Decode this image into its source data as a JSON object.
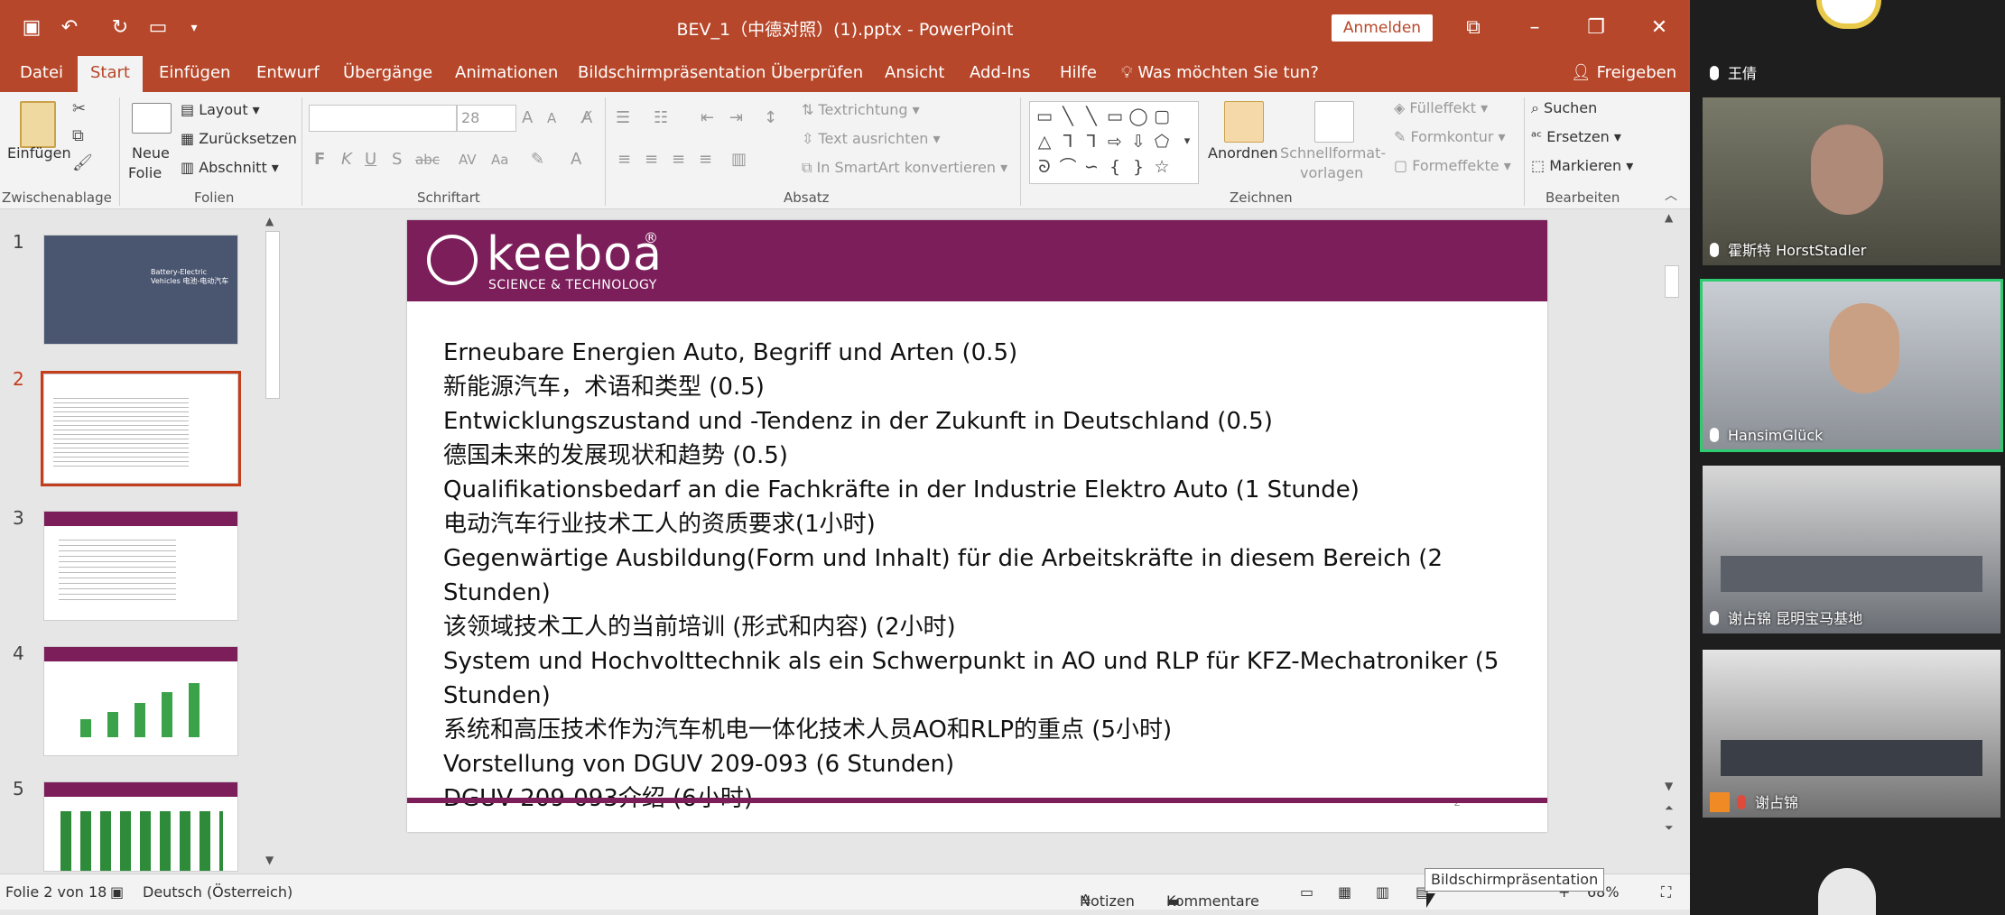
{
  "window": {
    "title": "BEV_1（中德对照）(1).pptx - PowerPoint",
    "signin_label": "Anmelden"
  },
  "quick_access": [
    "save-icon",
    "undo-icon",
    "redo-icon",
    "present-icon",
    "customize-icon"
  ],
  "menu": {
    "tabs": [
      "Datei",
      "Start",
      "Einfügen",
      "Entwurf",
      "Übergänge",
      "Animationen",
      "Bildschirmpräsentation",
      "Überprüfen",
      "Ansicht",
      "Add-Ins",
      "Hilfe"
    ],
    "active": "Start",
    "tell_me": "Was möchten Sie tun?",
    "share": "Freigeben"
  },
  "ribbon": {
    "clipboard": {
      "paste": "Einfügen",
      "group": "Zwischenablage"
    },
    "slides": {
      "new_slide_1": "Neue",
      "new_slide_2": "Folie",
      "layout": "Layout",
      "reset": "Zurücksetzen",
      "section": "Abschnitt",
      "group": "Folien"
    },
    "font": {
      "font_size": "28",
      "group": "Schriftart"
    },
    "paragraph": {
      "text_direction": "Textrichtung",
      "align_text": "Text ausrichten",
      "smartart": "In SmartArt konvertieren",
      "group": "Absatz"
    },
    "drawing": {
      "arrange": "Anordnen",
      "quick_styles_1": "Schnellformat-",
      "quick_styles_2": "vorlagen",
      "fill": "Fülleffekt",
      "outline": "Formkontur",
      "effects": "Formeffekte",
      "group": "Zeichnen"
    },
    "editing": {
      "find": "Suchen",
      "replace": "Ersetzen",
      "select": "Markieren",
      "group": "Bearbeiten"
    }
  },
  "thumbnails": [
    {
      "number": "1",
      "caption": "Battery-Electric Vehicles 电池-电动汽车"
    },
    {
      "number": "2",
      "caption": ""
    },
    {
      "number": "3",
      "caption": ""
    },
    {
      "number": "4",
      "caption": ""
    },
    {
      "number": "5",
      "caption": ""
    }
  ],
  "slide": {
    "logo_name": "keeboa",
    "logo_reg": "®",
    "logo_sub": "SCIENCE & TECHNOLOGY",
    "lines": [
      " Erneubare Energien Auto, Begriff und Arten (0.5)",
      "新能源汽车，术语和类型 (0.5)",
      " Entwicklungszustand und -Tendenz in der Zukunft in Deutschland (0.5)",
      "德国未来的发展现状和趋势 (0.5)",
      "Qualifikationsbedarf an die Fachkräfte in der Industrie Elektro Auto (1 Stunde)",
      "电动汽车行业技术工人的资质要求(1小时)",
      "Gegenwärtige Ausbildung(Form und Inhalt) für die Arbeitskräfte in diesem Bereich (2 Stunden)",
      "该领域技术工人的当前培训 (形式和内容) (2小时)",
      "System und Hochvolttechnik als ein Schwerpunkt in AO und RLP für KFZ-Mechatroniker (5 Stunden)",
      "系统和高压技术作为汽车机电一体化技术人员AO和RLP的重点 (5小时)",
      " Vorstellung von DGUV 209-093 (6 Stunden)",
      " DGUV 209-093介绍 (6小时)"
    ],
    "page_number": "2"
  },
  "status": {
    "slide_of": "Folie 2 von 18",
    "language": "Deutsch (Österreich)",
    "notes": "Notizen",
    "comments": "Kommentare",
    "zoom": "68%",
    "tooltip": "Bildschirmpräsentation"
  },
  "participants": [
    {
      "name": "王倩",
      "mic": "on",
      "video": false
    },
    {
      "name": "霍斯特 HorstStadler",
      "mic": "on",
      "video": true
    },
    {
      "name": "HansimGlück",
      "mic": "on",
      "video": true,
      "active": true
    },
    {
      "name": "谢占锦 昆明宝马基地",
      "mic": "on",
      "video": true
    },
    {
      "name": "谢占锦",
      "mic": "off",
      "video": true
    }
  ],
  "colors": {
    "accent": "#b7472a",
    "slide_brand": "#7b1e5a",
    "active_speaker": "#2ecc71"
  }
}
